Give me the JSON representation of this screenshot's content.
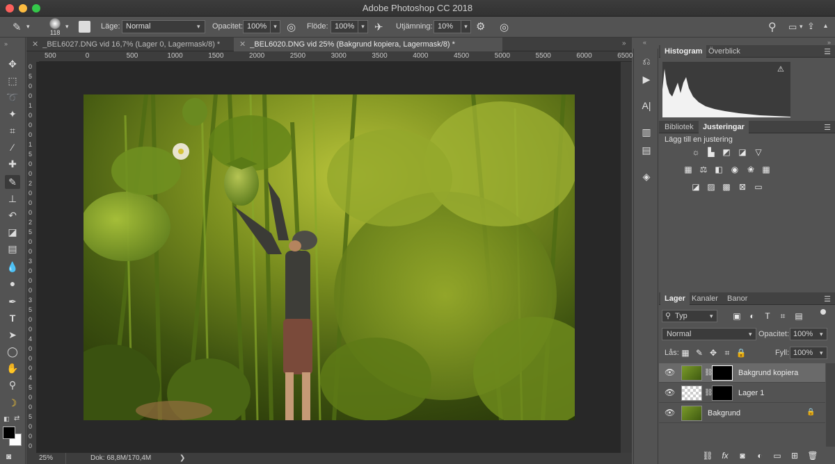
{
  "window": {
    "title": "Adobe Photoshop CC 2018"
  },
  "options_bar": {
    "brush_size": "118",
    "mode_label": "Läge:",
    "mode_value": "Normal",
    "opacity_label": "Opacitet:",
    "opacity_value": "100%",
    "flow_label": "Flöde:",
    "flow_value": "100%",
    "smoothing_label": "Utjämning:",
    "smoothing_value": "10%"
  },
  "tabs": [
    {
      "label": "_BEL6027.DNG vid 16,7% (Lager 0, Lagermask/8) *",
      "active": false
    },
    {
      "label": "_BEL6020.DNG vid 25% (Bakgrund kopiera, Lagermask/8) *",
      "active": true
    }
  ],
  "ruler_top": [
    "500",
    "0",
    "500",
    "1000",
    "1500",
    "2000",
    "2500",
    "3000",
    "3500",
    "4000",
    "4500",
    "5000",
    "5500",
    "6000",
    "6500"
  ],
  "ruler_left": [
    "0",
    "5",
    "0",
    "0",
    "1",
    "0",
    "0",
    "0",
    "1",
    "5",
    "0",
    "0",
    "2",
    "0",
    "0",
    "0",
    "2",
    "5",
    "0",
    "0",
    "3",
    "0",
    "0",
    "0",
    "3",
    "5",
    "0",
    "0",
    "4",
    "0",
    "0",
    "0",
    "4",
    "5",
    "0",
    "0",
    "5",
    "0",
    "0",
    "0"
  ],
  "status": {
    "zoom": "25%",
    "doc": "Dok: 68,8M/170,4M",
    "arrow": "❯"
  },
  "histogram_panel": {
    "tabs": [
      "Histogram",
      "Överblick"
    ]
  },
  "adjust_panel": {
    "tabs": [
      "Bibliotek",
      "Justeringar"
    ],
    "heading": "Lägg till en justering"
  },
  "layers_panel": {
    "tabs": [
      "Lager",
      "Kanaler",
      "Banor"
    ],
    "filter_value": "Typ",
    "blend_mode": "Normal",
    "opacity_label": "Opacitet:",
    "opacity_value": "100%",
    "lock_label": "Lås:",
    "fill_label": "Fyll:",
    "fill_value": "100%",
    "layers": [
      {
        "name": "Bakgrund kopiera",
        "selected": true
      },
      {
        "name": "Lager 1",
        "selected": false
      },
      {
        "name": "Bakgrund",
        "selected": false
      }
    ]
  },
  "colors": {
    "accent_fg": "#000000",
    "accent_bg": "#ffffff"
  }
}
